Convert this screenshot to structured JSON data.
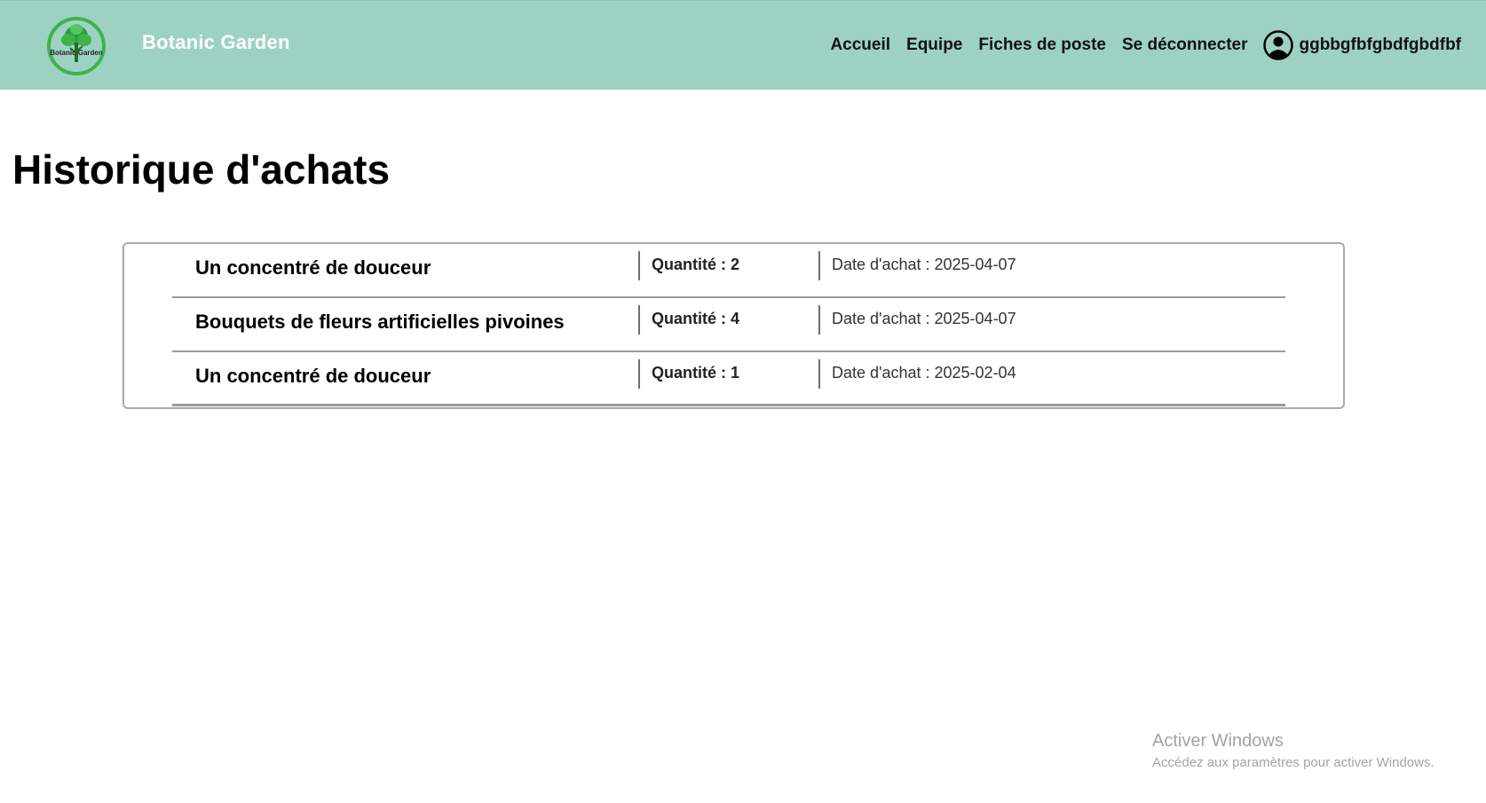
{
  "header": {
    "logo_text": "Botanic Garden",
    "brand": "Botanic Garden",
    "nav": [
      {
        "label": "Accueil"
      },
      {
        "label": "Equipe"
      },
      {
        "label": "Fiches de poste"
      },
      {
        "label": "Se déconnecter"
      }
    ],
    "user": {
      "name": "ggbbgfbfgbdfgbdfbf",
      "icon": "user-circle-icon"
    }
  },
  "main": {
    "title": "Historique d'achats",
    "purchases": [
      {
        "product": "Un concentré de douceur",
        "quantity": "Quantité : 2",
        "date": "Date d'achat : 2025-04-07"
      },
      {
        "product": "Bouquets de fleurs artificielles pivoines",
        "quantity": "Quantité : 4",
        "date": "Date d'achat : 2025-04-07"
      },
      {
        "product": "Un concentré de douceur",
        "quantity": "Quantité : 1",
        "date": "Date d'achat : 2025-02-04"
      }
    ]
  },
  "watermark": {
    "title": "Activer Windows",
    "subtitle": "Accédez aux paramètres pour activer Windows."
  },
  "colors": {
    "header_bg": "#9dd2c3",
    "brand_text": "#ffffff",
    "logo_green": "#3fb34a"
  }
}
